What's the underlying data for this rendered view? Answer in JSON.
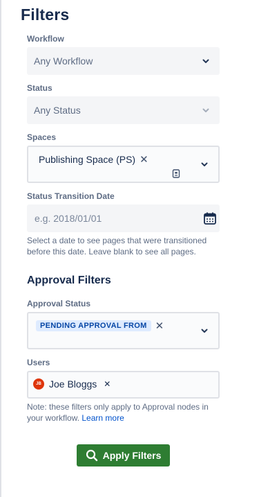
{
  "title": "Filters",
  "workflow": {
    "label": "Workflow",
    "value": "Any Workflow"
  },
  "status": {
    "label": "Status",
    "value": "Any Status"
  },
  "spaces": {
    "label": "Spaces",
    "chip": "Publishing Space (PS)",
    "remove_icon": "close-icon",
    "extra_icon": "book-icon"
  },
  "transition_date": {
    "label": "Status Transition Date",
    "placeholder": "e.g. 2018/01/01",
    "icon": "calendar-icon",
    "help": "Select a date to see pages that were transitioned before this date. Leave blank to see all pages."
  },
  "approval": {
    "section_title": "Approval Filters",
    "status_label": "Approval Status",
    "status_chip": "PENDING APPROVAL FROM",
    "users_label": "Users",
    "user": {
      "initials": "JB",
      "name": "Joe Bloggs"
    },
    "note": "Note: these filters only apply to Approval nodes in your workflow.",
    "learn_more": "Learn more"
  },
  "apply_button": "Apply Filters",
  "colors": {
    "primary_button": "#2e7d32",
    "link": "#0052cc",
    "lozenge_bg": "#deebff",
    "avatar": "#de350b"
  }
}
